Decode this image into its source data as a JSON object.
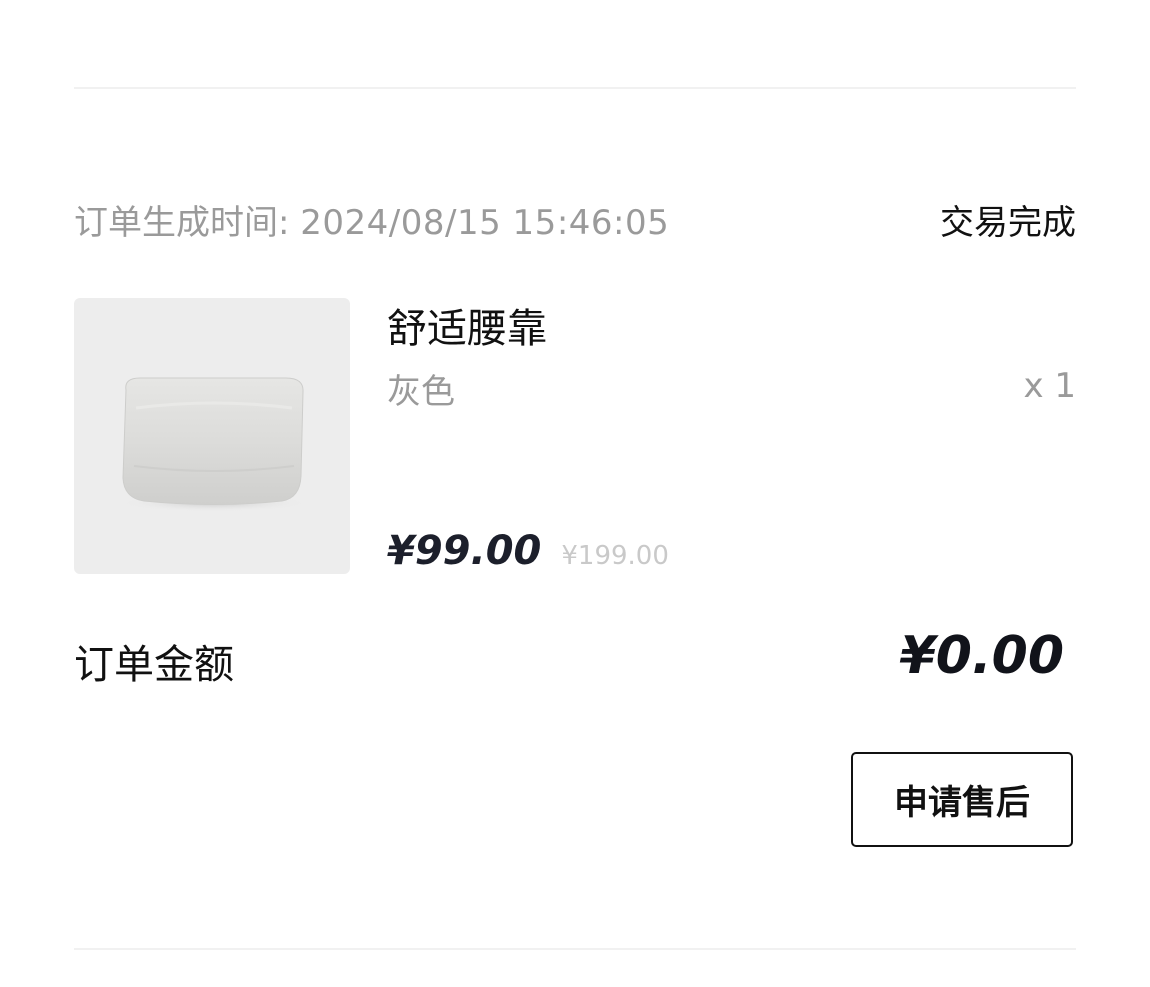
{
  "order": {
    "time_label": "订单生成时间:",
    "time_value": "2024/08/15 15:46:05",
    "status": "交易完成"
  },
  "product": {
    "name": "舒适腰靠",
    "spec": "灰色",
    "quantity": "x 1",
    "price": "¥99.00",
    "original_price": "¥199.00",
    "image_icon": "lumbar-pillow-image"
  },
  "summary": {
    "amount_label": "订单金额",
    "amount_value": "¥0.00"
  },
  "actions": {
    "after_sale_label": "申请售后"
  },
  "colors": {
    "primary_text": "#111111",
    "secondary_text": "#9a9a9a",
    "strike_price": "#c9c9c9",
    "price_text": "#1c1f2b"
  }
}
